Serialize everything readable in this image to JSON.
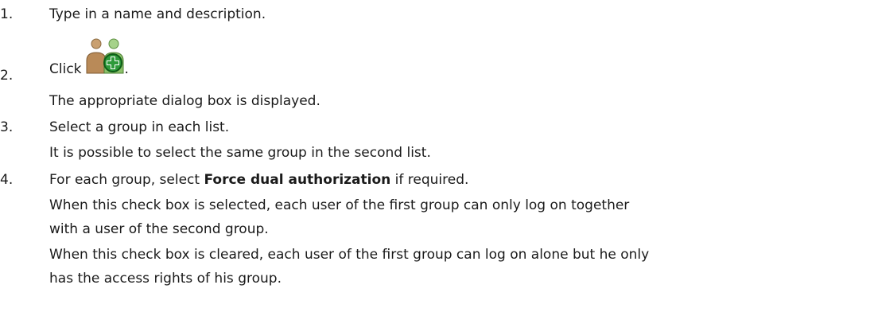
{
  "steps": [
    {
      "number": "1.",
      "lines": [
        "Type in a name and description."
      ]
    },
    {
      "number": "2.",
      "click_label": "Click",
      "click_suffix": ".",
      "icon": "add-user-group-icon",
      "lines": [
        "The appropriate dialog box is displayed."
      ]
    },
    {
      "number": "3.",
      "lines": [
        "Select a group in each list.",
        "It is possible to select the same group in the second list."
      ]
    },
    {
      "number": "4.",
      "line1_prefix": "For each group, select ",
      "line1_bold": "Force dual authorization",
      "line1_suffix": " if required.",
      "lines": [
        "When this check box is selected, each user of the first group can only log on together",
        "with a user of the second group.",
        "When this check box is cleared, each user of the first group can log on alone but he only",
        "has the access rights of his group."
      ]
    }
  ],
  "colors": {
    "text": "#1a1a1a",
    "icon_person_left": "#c9a070",
    "icon_person_right": "#8cc06a",
    "icon_plus_bg": "#2e9a3a"
  }
}
